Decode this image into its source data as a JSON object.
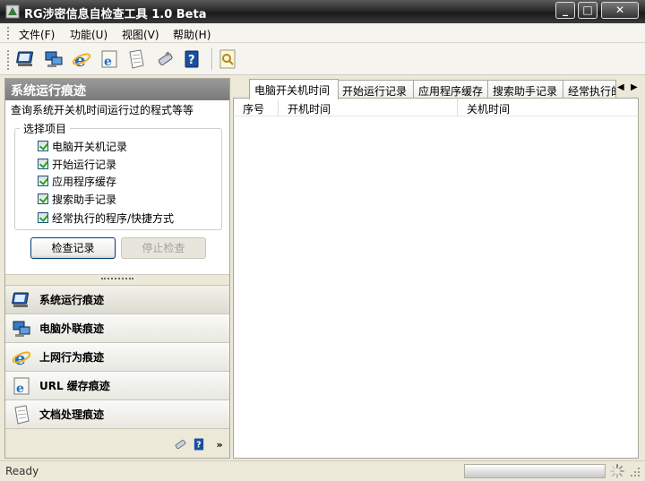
{
  "window": {
    "title": "RG涉密信息自检查工具 1.0 Beta"
  },
  "title_buttons": {
    "minimize": "_",
    "maximize": "□",
    "close": "✕"
  },
  "menu": [
    {
      "label": "文件(F)"
    },
    {
      "label": "功能(U)"
    },
    {
      "label": "视图(V)"
    },
    {
      "label": "帮助(H)"
    }
  ],
  "toolbar": {
    "icons": [
      "monitor-icon",
      "network-pc-icon",
      "ie-browser-icon",
      "url-cache-icon",
      "document-icon",
      "usb-drive-icon",
      "help-icon",
      "search-file-icon"
    ]
  },
  "left_panel": {
    "header": "系统运行痕迹",
    "description": "查询系统开关机时间运行过的程式等等",
    "group_label": "选择项目",
    "checkboxes": [
      {
        "label": "电脑开关机记录",
        "checked": true
      },
      {
        "label": "开始运行记录",
        "checked": true
      },
      {
        "label": "应用程序缓存",
        "checked": true
      },
      {
        "label": "搜索助手记录",
        "checked": true
      },
      {
        "label": "经常执行的程序/快捷方式",
        "checked": true
      }
    ],
    "start_button": "检查记录",
    "stop_button": "停止检查"
  },
  "nav": [
    {
      "label": "系统运行痕迹",
      "icon": "monitor-icon"
    },
    {
      "label": "电脑外联痕迹",
      "icon": "network-pc-icon"
    },
    {
      "label": "上网行为痕迹",
      "icon": "ie-browser-icon"
    },
    {
      "label": "URL 缓存痕迹",
      "icon": "url-cache-icon"
    },
    {
      "label": "文档处理痕迹",
      "icon": "document-icon"
    }
  ],
  "nav_footer": {
    "more": "»"
  },
  "tabs": [
    {
      "label": "电脑开关机时间",
      "active": true
    },
    {
      "label": "开始运行记录"
    },
    {
      "label": "应用程序缓存"
    },
    {
      "label": "搜索助手记录"
    },
    {
      "label": "经常执行的"
    }
  ],
  "tab_arrows": {
    "left": "◀",
    "right": "▶"
  },
  "table": {
    "columns": [
      "序号",
      "开机时间",
      "关机时间"
    ]
  },
  "status": {
    "text": "Ready"
  }
}
